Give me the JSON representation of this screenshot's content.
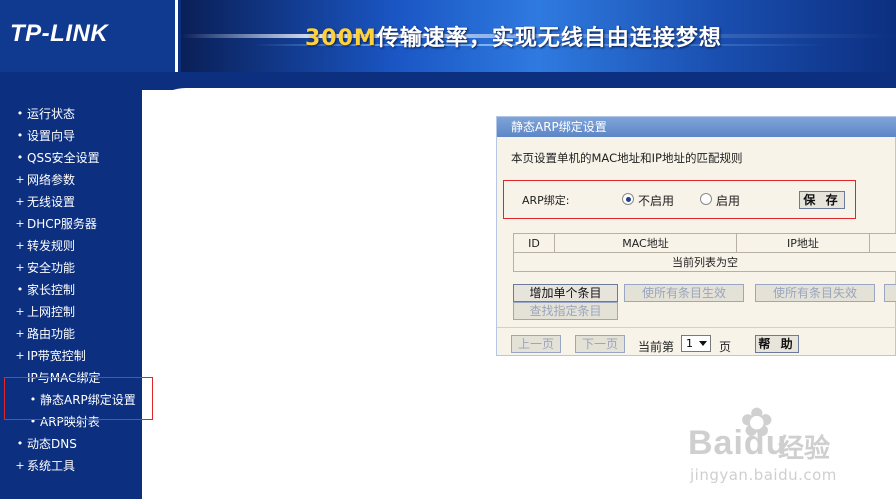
{
  "header": {
    "logo": "TP-LINK",
    "slogan_highlight": "300M",
    "slogan_rest": "传输速率，实现无线自由连接梦想"
  },
  "sidebar": {
    "items": [
      {
        "label": "运行状态",
        "bullet": "•"
      },
      {
        "label": "设置向导",
        "bullet": "•"
      },
      {
        "label": "QSS安全设置",
        "bullet": "•"
      },
      {
        "label": "网络参数",
        "bullet": "+"
      },
      {
        "label": "无线设置",
        "bullet": "+"
      },
      {
        "label": "DHCP服务器",
        "bullet": "+"
      },
      {
        "label": "转发规则",
        "bullet": "+"
      },
      {
        "label": "安全功能",
        "bullet": "+"
      },
      {
        "label": "家长控制",
        "bullet": "•"
      },
      {
        "label": "上网控制",
        "bullet": "+"
      },
      {
        "label": "路由功能",
        "bullet": "+"
      },
      {
        "label": "IP带宽控制",
        "bullet": "+"
      },
      {
        "label": "IP与MAC绑定",
        "bullet": "−"
      },
      {
        "label": "静态ARP绑定设置",
        "bullet": "•",
        "sub": true,
        "active": true
      },
      {
        "label": "ARP映射表",
        "bullet": "•",
        "sub": true
      },
      {
        "label": "动态DNS",
        "bullet": "•"
      },
      {
        "label": "系统工具",
        "bullet": "+"
      }
    ]
  },
  "panel": {
    "title": "静态ARP绑定设置",
    "description": "本页设置单机的MAC地址和IP地址的匹配规则",
    "arp_label": "ARP绑定:",
    "option_disable": "不启用",
    "option_enable": "启用",
    "selected": "disable",
    "save_label": "保 存",
    "table": {
      "headers": [
        "ID",
        "MAC地址",
        "IP地址",
        ""
      ],
      "empty_text": "当前列表为空"
    },
    "actions": {
      "add": "增加单个条目",
      "enable_all": "使所有条目生效",
      "disable_all": "使所有条目失效",
      "find": "查找指定条目"
    },
    "pager": {
      "prev": "上一页",
      "next": "下一页",
      "current_prefix": "当前第",
      "page_value": "1",
      "page_suffix": "页",
      "help": "帮 助"
    }
  },
  "watermark": {
    "brand": "Bai",
    "brand2": "du",
    "cn": "经验",
    "url": "jingyan.baidu.com"
  },
  "colors": {
    "header_blue": "#0c2f80",
    "panel_title": "#6a90cc",
    "panel_bg": "#f7f3e9",
    "annotation_red": "#e0262b"
  }
}
